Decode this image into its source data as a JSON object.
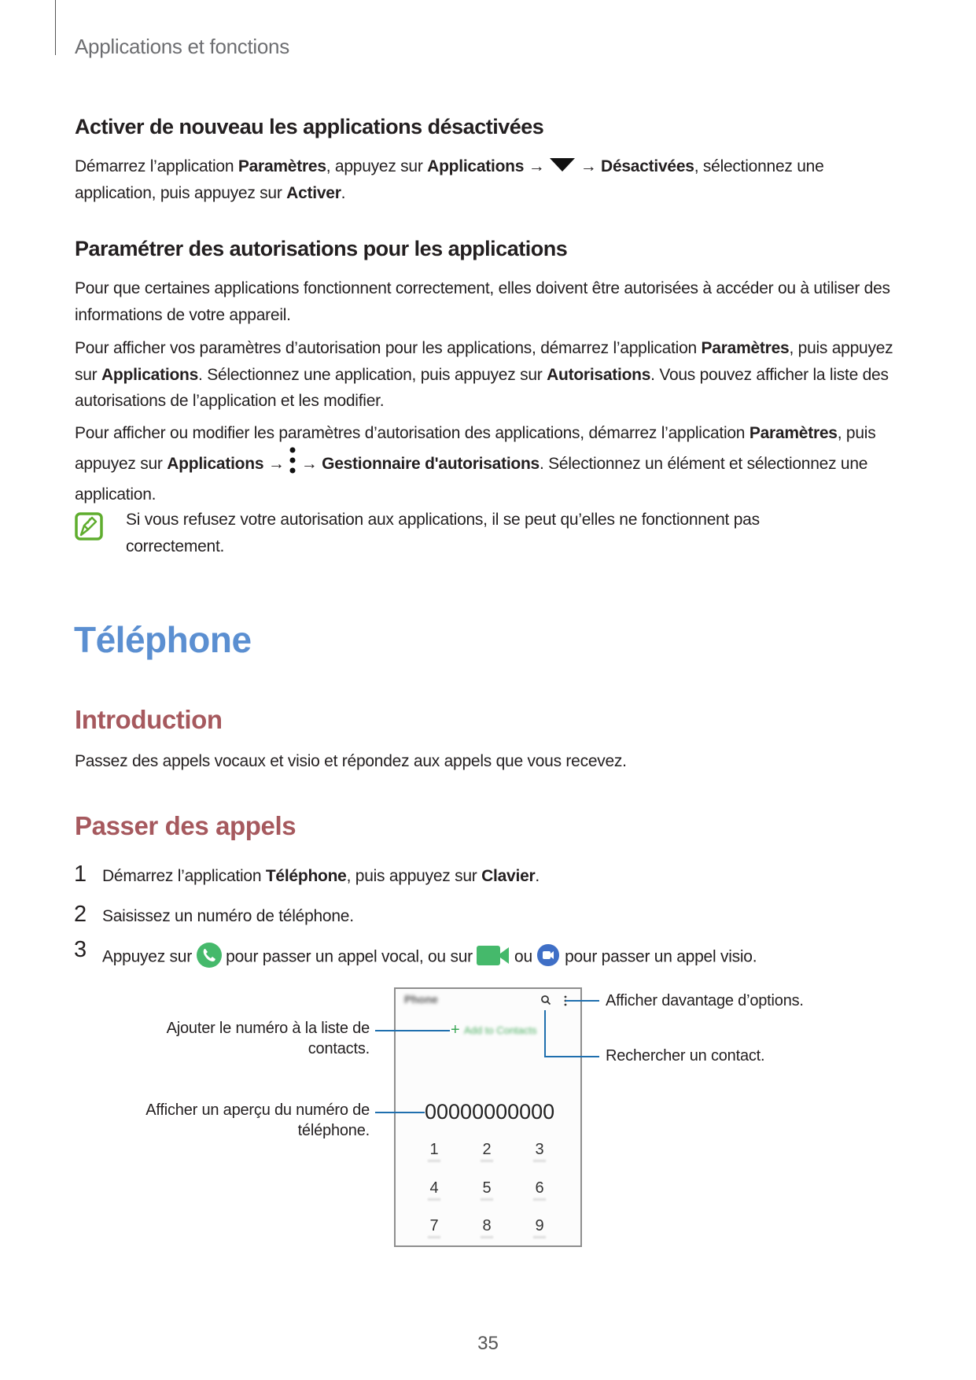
{
  "header": {
    "title": "Applications et fonctions"
  },
  "section1": {
    "heading": "Activer de nouveau les applications désactivées",
    "paragraph": [
      {
        "t": "Démarrez l’application "
      },
      {
        "t": "Paramètres",
        "b": true
      },
      {
        "t": ", appuyez sur "
      },
      {
        "t": "Applications",
        "b": true
      },
      {
        "t": " → "
      },
      {
        "icon": "dropdown-triangle-icon"
      },
      {
        "t": " → "
      },
      {
        "t": "Désactivées",
        "b": true
      },
      {
        "t": ", sélectionnez une application, puis appuyez sur "
      },
      {
        "t": "Activer",
        "b": true
      },
      {
        "t": "."
      }
    ]
  },
  "section2": {
    "heading": "Paramétrer des autorisations pour les applications",
    "paragraphs": [
      [
        {
          "t": "Pour que certaines applications fonctionnent correctement, elles doivent être autorisées à accéder ou à utiliser des informations de votre appareil."
        }
      ],
      [
        {
          "t": "Pour afficher vos paramètres d’autorisation pour les applications, démarrez l’application "
        },
        {
          "t": "Paramètres",
          "b": true
        },
        {
          "t": ", puis appuyez sur "
        },
        {
          "t": "Applications",
          "b": true
        },
        {
          "t": ". Sélectionnez une application, puis appuyez sur "
        },
        {
          "t": "Autorisations",
          "b": true
        },
        {
          "t": ". Vous pouvez afficher la liste des autorisations de l’application et les modifier."
        }
      ],
      [
        {
          "t": "Pour afficher ou modifier les paramètres d’autorisation des applications, démarrez l’application "
        },
        {
          "t": "Paramètres",
          "b": true
        },
        {
          "t": ", puis appuyez sur "
        },
        {
          "t": "Applications",
          "b": true
        },
        {
          "t": " → "
        },
        {
          "icon": "more-options-icon"
        },
        {
          "t": " → "
        },
        {
          "t": "Gestionnaire d'autorisations",
          "b": true
        },
        {
          "t": ". Sélectionnez un élément et sélectionnez une application."
        }
      ]
    ],
    "note": "Si vous refusez votre autorisation aux applications, il se peut qu’elles ne fonctionnent pas correctement."
  },
  "chapter": {
    "title": "Téléphone"
  },
  "intro": {
    "heading": "Introduction",
    "text": "Passez des appels vocaux et visio et répondez aux appels que vous recevez."
  },
  "calls": {
    "heading": "Passer des appels",
    "steps": [
      {
        "n": "1",
        "segs": [
          {
            "t": "Démarrez l’application "
          },
          {
            "t": "Téléphone",
            "b": true
          },
          {
            "t": ", puis appuyez sur "
          },
          {
            "t": "Clavier",
            "b": true
          },
          {
            "t": "."
          }
        ]
      },
      {
        "n": "2",
        "segs": [
          {
            "t": "Saisissez un numéro de téléphone."
          }
        ]
      },
      {
        "n": "3",
        "segs": [
          {
            "t": "Appuyez sur "
          },
          {
            "icon": "phone-call-icon"
          },
          {
            "t": " pour passer un appel vocal, ou sur "
          },
          {
            "icon": "video-call-icon"
          },
          {
            "t": " ou "
          },
          {
            "icon": "duo-video-icon"
          },
          {
            "t": " pour passer un appel visio."
          }
        ]
      }
    ]
  },
  "mockup": {
    "app_title": "Phone",
    "add_contact": "Add to Contacts",
    "number": "00000000000",
    "keys": [
      "1",
      "2",
      "3",
      "4",
      "5",
      "6",
      "7",
      "8",
      "9"
    ],
    "callouts": {
      "more": "Afficher davantage d’options.",
      "search": "Rechercher un contact.",
      "add_1": "Ajouter le numéro à la liste de",
      "add_2": "contacts.",
      "preview_1": "Afficher un aperçu du numéro de",
      "preview_2": "téléphone."
    }
  },
  "colors": {
    "chapter": "#5b8fd1",
    "section": "#a6595e",
    "callout_line": "#1f6fae",
    "note_icon": "#5fad2e",
    "phone_green": "#45b96b",
    "duo_blue": "#3f6fc6"
  },
  "page_number": "35"
}
